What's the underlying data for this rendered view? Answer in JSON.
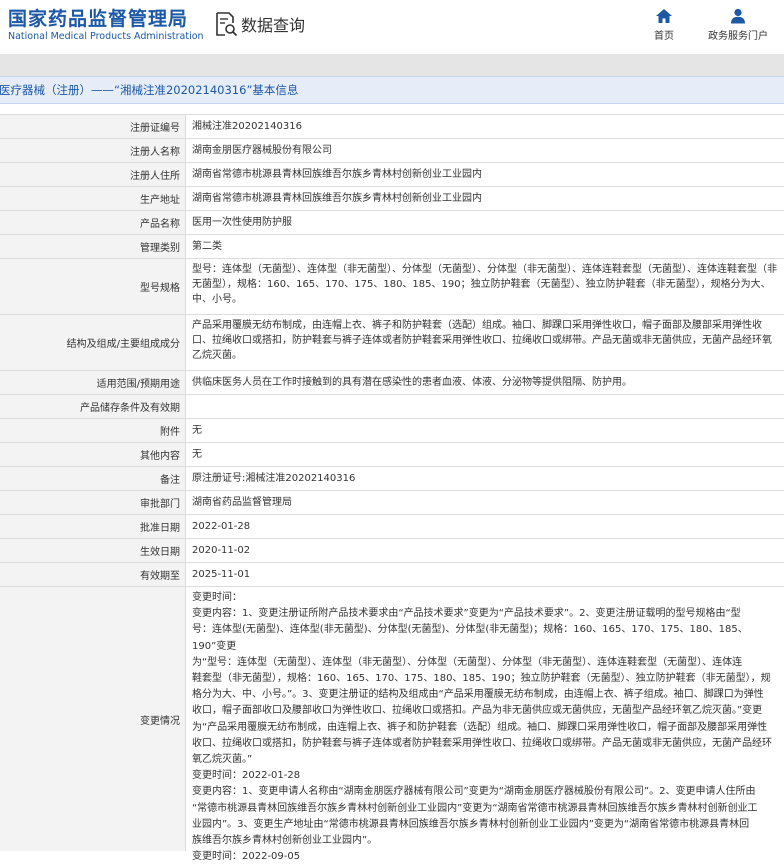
{
  "header": {
    "logo_cn": "国家药品监督管理局",
    "logo_en": "National Medical Products Administration",
    "search_title": "数据查询",
    "nav": [
      {
        "label": "首页",
        "icon": "home-icon"
      },
      {
        "label": "政务服务门户",
        "icon": "user-icon"
      }
    ]
  },
  "title_bar": {
    "text": "医疗器械（注册）——“湘械注准20202140316”基本信息"
  },
  "colors": {
    "brand": "#1c58a6",
    "label_bg": "#f3f3f3",
    "border": "#dcdcdc",
    "title_bg": "#e6edf8"
  },
  "fields": [
    {
      "label": "注册证编号",
      "value": "湘械注准20202140316"
    },
    {
      "label": "注册人名称",
      "value": "湖南金朋医疗器械股份有限公司"
    },
    {
      "label": "注册人住所",
      "value": "湖南省常德市桃源县青林回族维吾尔族乡青林村创新创业工业园内"
    },
    {
      "label": "生产地址",
      "value": "湖南省常德市桃源县青林回族维吾尔族乡青林村创新创业工业园内"
    },
    {
      "label": "产品名称",
      "value": "医用一次性使用防护服"
    },
    {
      "label": "管理类别",
      "value": "第二类"
    },
    {
      "label": "型号规格",
      "value": "型号：连体型（无菌型）、连体型（非无菌型）、分体型（无菌型）、分体型（非无菌型）、连体连鞋套型（无菌型）、连体连鞋套型（非无菌型），规格：160、165、170、175、180、185、190；独立防护鞋套（无菌型）、独立防护鞋套（非无菌型），规格分为大、中、小号。"
    },
    {
      "label": "结构及组成/主要组成成分",
      "value": "产品采用覆膜无纺布制成，由连帽上衣、裤子和防护鞋套（选配）组成。袖口、脚踝口采用弹性收口，帽子面部及腰部采用弹性收口、拉绳收口或搭扣，防护鞋套与裤子连体或者防护鞋套采用弹性收口、拉绳收口或绑带。产品无菌或非无菌供应，无菌产品经环氧乙烷灭菌。"
    },
    {
      "label": "适用范围/预期用途",
      "value": "供临床医务人员在工作时接触到的具有潜在感染性的患者血液、体液、分泌物等提供阻隔、防护用。"
    },
    {
      "label": "产品储存条件及有效期",
      "value": ""
    },
    {
      "label": "附件",
      "value": "无"
    },
    {
      "label": "其他内容",
      "value": "无"
    },
    {
      "label": "备注",
      "value": "原注册证号:湘械注准20202140316"
    },
    {
      "label": "审批部门",
      "value": "湖南省药品监督管理局"
    },
    {
      "label": "批准日期",
      "value": "2022-01-28"
    },
    {
      "label": "生效日期",
      "value": "2020-11-02"
    },
    {
      "label": "有效期至",
      "value": "2025-11-01"
    }
  ],
  "change_history": {
    "label": "变更情况",
    "lines": [
      "变更时间：",
      "变更内容：1、变更注册证所附产品技术要求由“产品技术要求”变更为“产品技术要求”。2、变更注册证载明的型号规格由“型",
      "号：连体型(无菌型)、连体型(非无菌型)、分体型(无菌型)、分体型(非无菌型)；规格：160、165、170、175、180、185、190”变更",
      "为“型号：连体型（无菌型）、连体型（非无菌型）、分体型（无菌型）、分体型（非无菌型）、连体连鞋套型（无菌型）、连体连",
      "鞋套型（非无菌型），规格：160、165、170、175、180、185、190；独立防护鞋套（无菌型）、独立防护鞋套（非无菌型），规",
      "格分为大、中、小号。”。3、变更注册证的结构及组成由“产品采用覆膜无纺布制成，由连帽上衣、裤子组成。袖口、脚踝口为弹性",
      "收口，帽子面部收口及腰部收口为弹性收口、拉绳收口或搭扣。产品为非无菌供应或无菌供应，无菌型产品经环氧乙烷灭菌。”变更",
      "为“产品采用覆膜无纺布制成，由连帽上衣、裤子和防护鞋套（选配）组成。袖口、脚踝口采用弹性收口，帽子面部及腰部采用弹性",
      "收口、拉绳收口或搭扣，防护鞋套与裤子连体或者防护鞋套采用弹性收口、拉绳收口或绑带。产品无菌或非无菌供应，无菌产品经环",
      "氧乙烷灭菌。”",
      "变更时间：2022-01-28",
      "变更内容：1、变更申请人名称由“湖南金朋医疗器械有限公司”变更为“湖南金朋医疗器械股份有限公司”。2、变更申请人住所由",
      "“常德市桃源县青林回族维吾尔族乡青林村创新创业工业园内”变更为“湖南省常德市桃源县青林回族维吾尔族乡青林村创新创业工",
      "业园内”。3、变更生产地址由“常德市桃源县青林回族维吾尔族乡青林村创新创业工业园内”变更为“湖南省常德市桃源县青林回",
      "族维吾尔族乡青林村创新创业工业园内”。",
      "变更时间：2022-09-05"
    ]
  }
}
